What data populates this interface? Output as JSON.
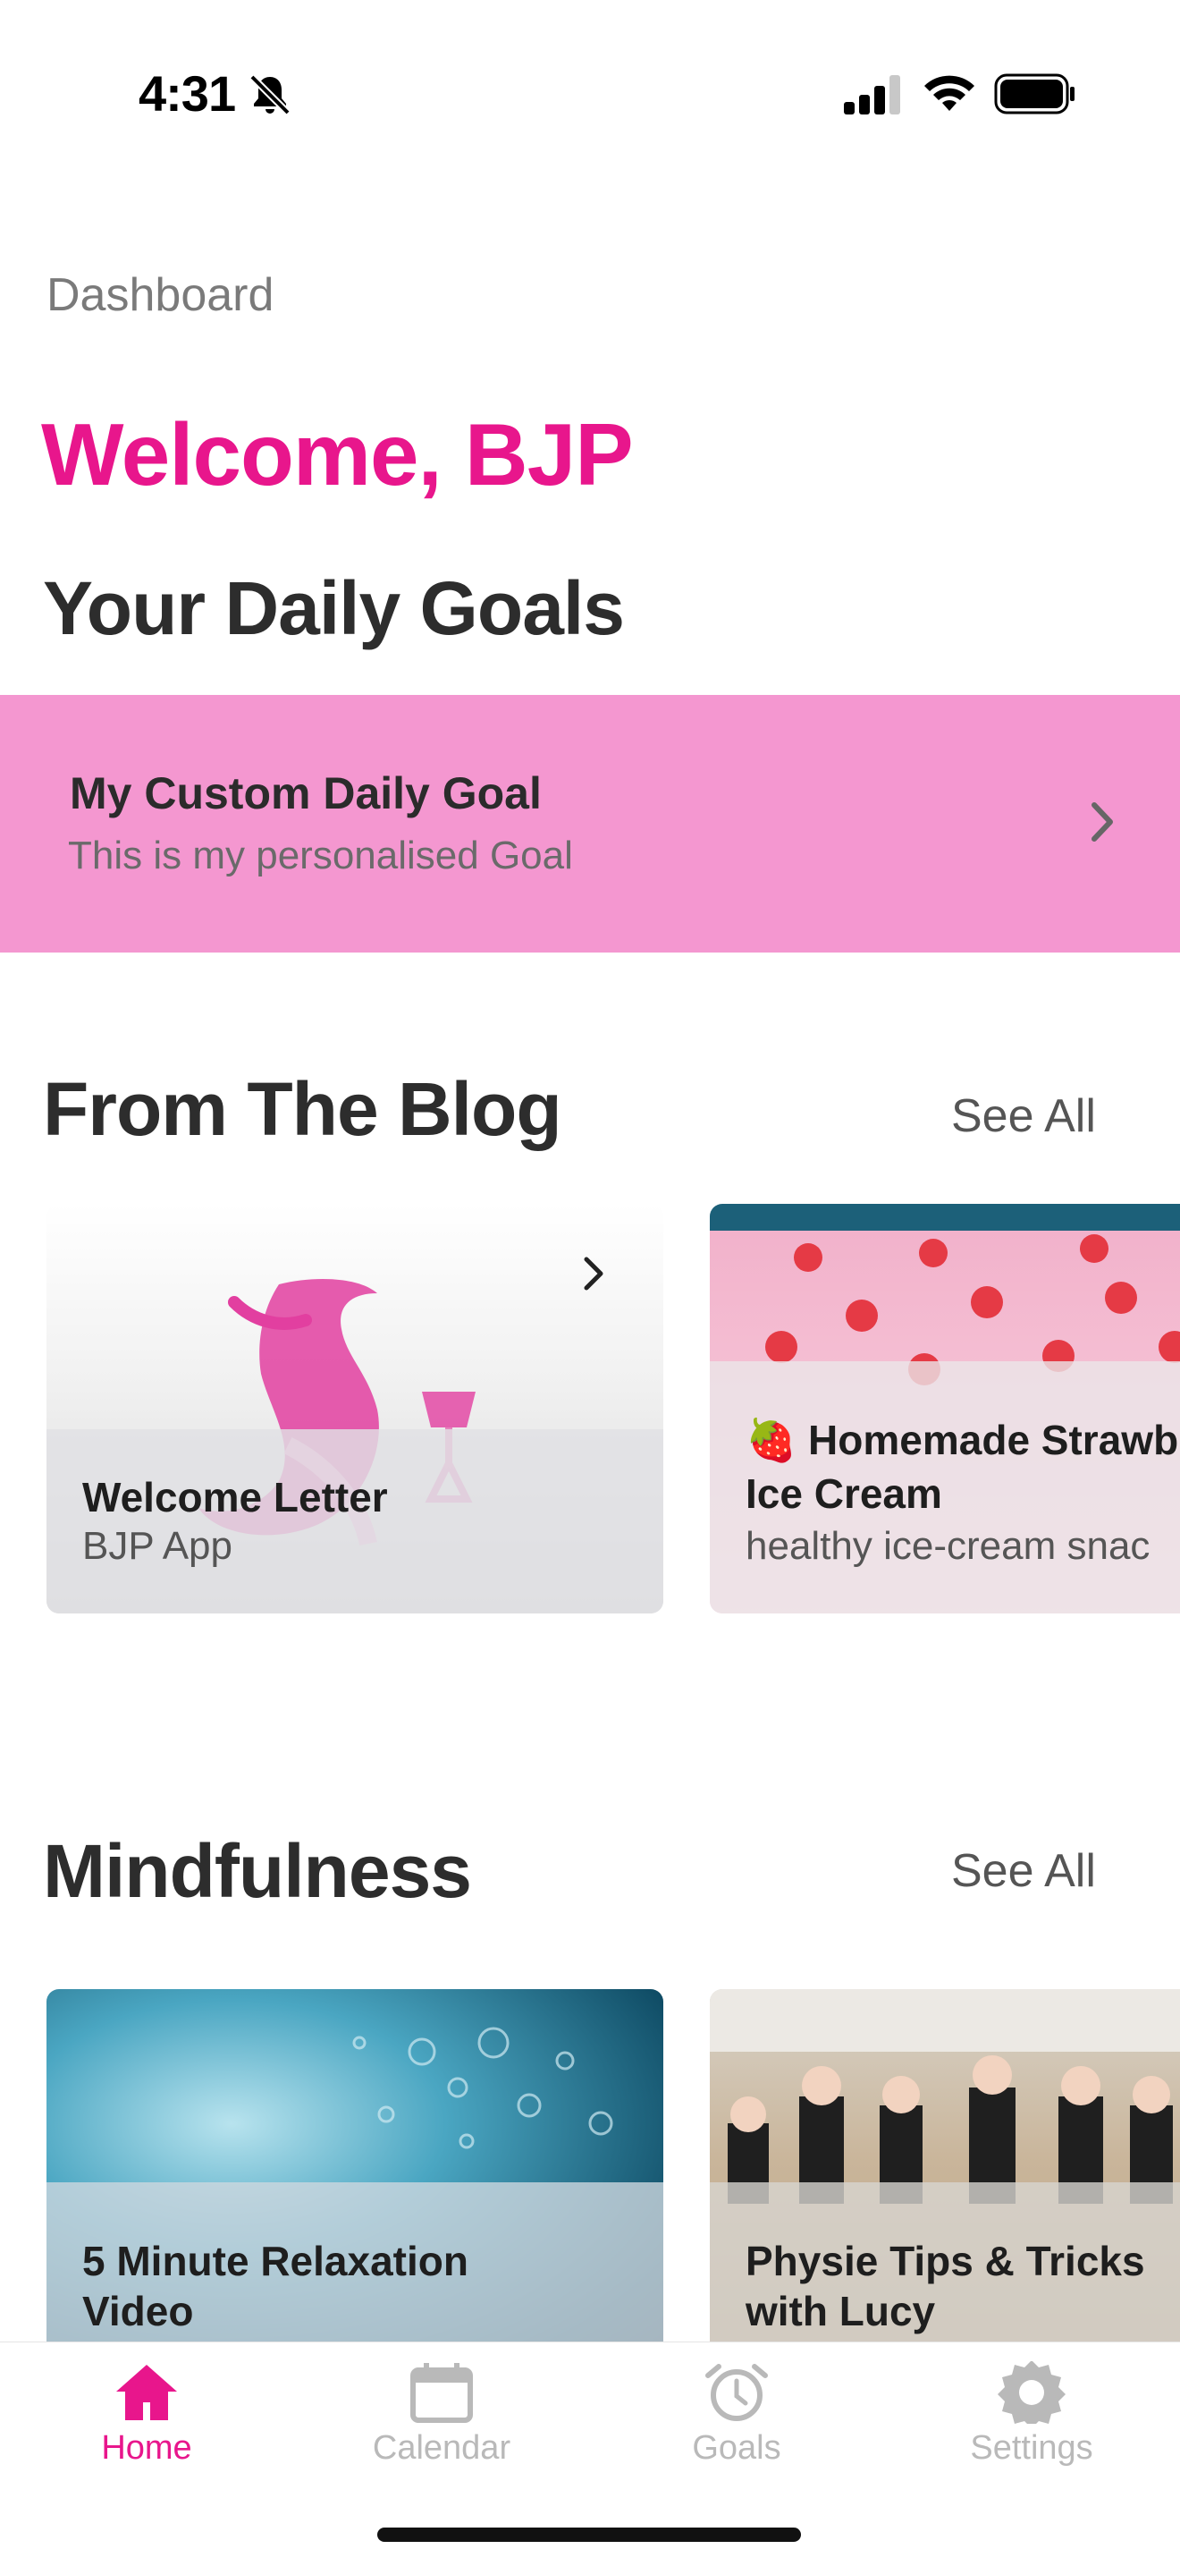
{
  "status_bar": {
    "time": "4:31"
  },
  "header": {
    "breadcrumb": "Dashboard",
    "welcome": "Welcome, BJP"
  },
  "daily_goals": {
    "heading": "Your Daily Goals",
    "card": {
      "title": "My Custom Daily Goal",
      "subtitle": "This is my personalised Goal"
    }
  },
  "blog": {
    "heading": "From The Blog",
    "see_all": "See All",
    "cards": [
      {
        "title": "Welcome Letter",
        "subtitle": "BJP App"
      },
      {
        "title_line1": "🍓 Homemade Strawb",
        "title_line2": "Ice Cream",
        "subtitle": "healthy ice-cream snac"
      }
    ]
  },
  "mindfulness": {
    "heading": "Mindfulness",
    "see_all": "See All",
    "cards": [
      {
        "title_line1": "5 Minute Relaxation",
        "title_line2": "Video"
      },
      {
        "title_line1": "Physie Tips & Tricks",
        "title_line2": "with Lucy"
      }
    ]
  },
  "tab_bar": {
    "tabs": [
      {
        "label": "Home",
        "icon": "home-icon",
        "active": true
      },
      {
        "label": "Calendar",
        "icon": "calendar-icon",
        "active": false
      },
      {
        "label": "Goals",
        "icon": "alarm-icon",
        "active": false
      },
      {
        "label": "Settings",
        "icon": "gear-icon",
        "active": false
      }
    ]
  },
  "colors": {
    "accent": "#e8168c",
    "goal_card": "#f497d0",
    "inactive_tab": "#b9b9b9"
  }
}
